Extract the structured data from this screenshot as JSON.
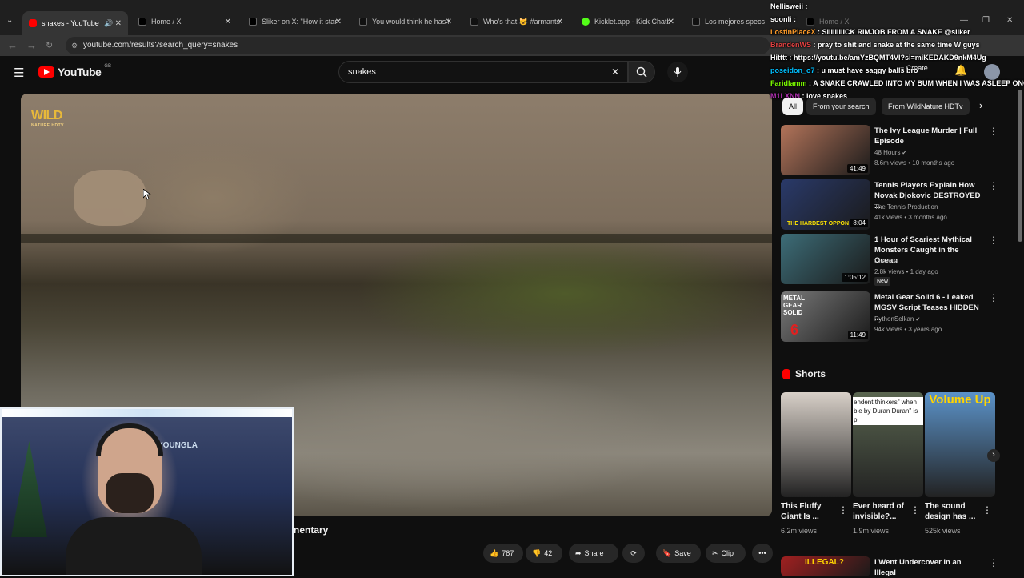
{
  "browser": {
    "tabs": [
      {
        "label": "snakes - YouTube",
        "fav": "#ff0000"
      },
      {
        "label": "Home / X",
        "fav": "#000000"
      },
      {
        "label": "Sliker on X: \"How it starte",
        "fav": "#000000"
      },
      {
        "label": "You would think he has le",
        "fav": "#111111"
      },
      {
        "label": "Who's that 😺 #armants",
        "fav": "#111111"
      },
      {
        "label": "Kicklet.app - Kick Chatbo",
        "fav": "#53fc18"
      },
      {
        "label": "Los mejores specs de Bl",
        "fav": "#111111"
      },
      {
        "label": "Home / X",
        "fav": "#000000"
      }
    ],
    "url": "youtube.com/results?search_query=snakes"
  },
  "youtube": {
    "logo_text": "YouTube",
    "region": "GB",
    "search_value": "snakes",
    "create_label": "Create"
  },
  "video": {
    "channel_logo": "WILD",
    "channel_logo_sub": "NATURE HDTV",
    "title_fragment": "nentary",
    "likes": "787",
    "dislikes": "42",
    "share_label": "Share",
    "save_label": "Save",
    "clip_label": "Clip"
  },
  "webcam": {
    "banner": "YOUNGLA"
  },
  "chat": [
    {
      "user": "Nellisweii",
      "msg": "",
      "color": "#ffffff"
    },
    {
      "user": "soonli",
      "msg": "",
      "color": "#ffffff"
    },
    {
      "user": "LostinPlaceX",
      "msg": "SIIIIIIIIICK RIMJOB FROM A SNAKE @sliker",
      "color": "#ff9c2a"
    },
    {
      "user": "BrandenWS",
      "msg": "pray to shit and snake at the same time W guys",
      "color": "#e04040"
    },
    {
      "user": "Hitttt",
      "msg": "https://youtu.be/amYzBQMT4VI?si=miKEDAKD9nkM4Ug",
      "color": "#ffffff"
    },
    {
      "user": "poseidon_o7",
      "msg": "u must have saggy balls bro",
      "color": "#00bfff"
    },
    {
      "user": "Faridlamm",
      "msg": "A SNAKE CRAWLED INTO MY BUM WHEN I WAS ASLEEP ONCE",
      "color": "#7cfc00"
    },
    {
      "user": "M1LXNN",
      "msg": "love snakes",
      "color": "#b030b0"
    }
  ],
  "filters": [
    "All",
    "From your search",
    "From WildNature HDTv"
  ],
  "related": [
    {
      "title": "The Ivy League Murder | Full Episode",
      "channel": "48 Hours",
      "verified": true,
      "meta": "8.6m views • 10 months ago",
      "duration": "41:49",
      "new": false,
      "color": "#b3745a"
    },
    {
      "title": "Tennis Players Explain How Novak Djokovic DESTROYED ...",
      "channel": "The Tennis Production",
      "verified": false,
      "meta": "41k views • 3 months ago",
      "duration": "8:04",
      "new": false,
      "color": "#2a3a6a"
    },
    {
      "title": "1 Hour of Scariest Mythical Monsters Caught in the Ocean",
      "channel": "Claws",
      "verified": true,
      "meta": "2.8k views • 1 day ago",
      "duration": "1:05:12",
      "new": true,
      "badge": "New",
      "color": "#3d6d78"
    },
    {
      "title": "Metal Gear Solid 6 - Leaked MGSV Script Teases HIDDEN ...",
      "channel": "PythonSelkan",
      "verified": true,
      "meta": "94k views • 3 years ago",
      "duration": "11:49",
      "new": false,
      "color": "#7a7a7a"
    },
    {
      "title": "I Went Undercover in an Illegal",
      "channel": "",
      "verified": false,
      "meta": "",
      "duration": "",
      "new": false,
      "color": "#a02020"
    }
  ],
  "thumb_texts": {
    "tennis": "THE HARDEST OPPON",
    "mgs": "METAL GEAR SOLID",
    "mgs_num": "6",
    "illegal": "ILLEGAL?"
  },
  "shorts": {
    "header": "Shorts",
    "items": [
      {
        "title": "This Fluffy Giant Is ...",
        "views": "6.2m views",
        "color": "#d8d0c8",
        "caption": ""
      },
      {
        "title": "Ever heard of invisible?...",
        "views": "1.9m views",
        "color": "#5a6650",
        "caption": "endent thinkers\" when ble by Duran Duran\" is pl"
      },
      {
        "title": "The sound design has ...",
        "views": "525k views",
        "color": "#5b92c8",
        "caption": "Volume Up"
      }
    ]
  }
}
